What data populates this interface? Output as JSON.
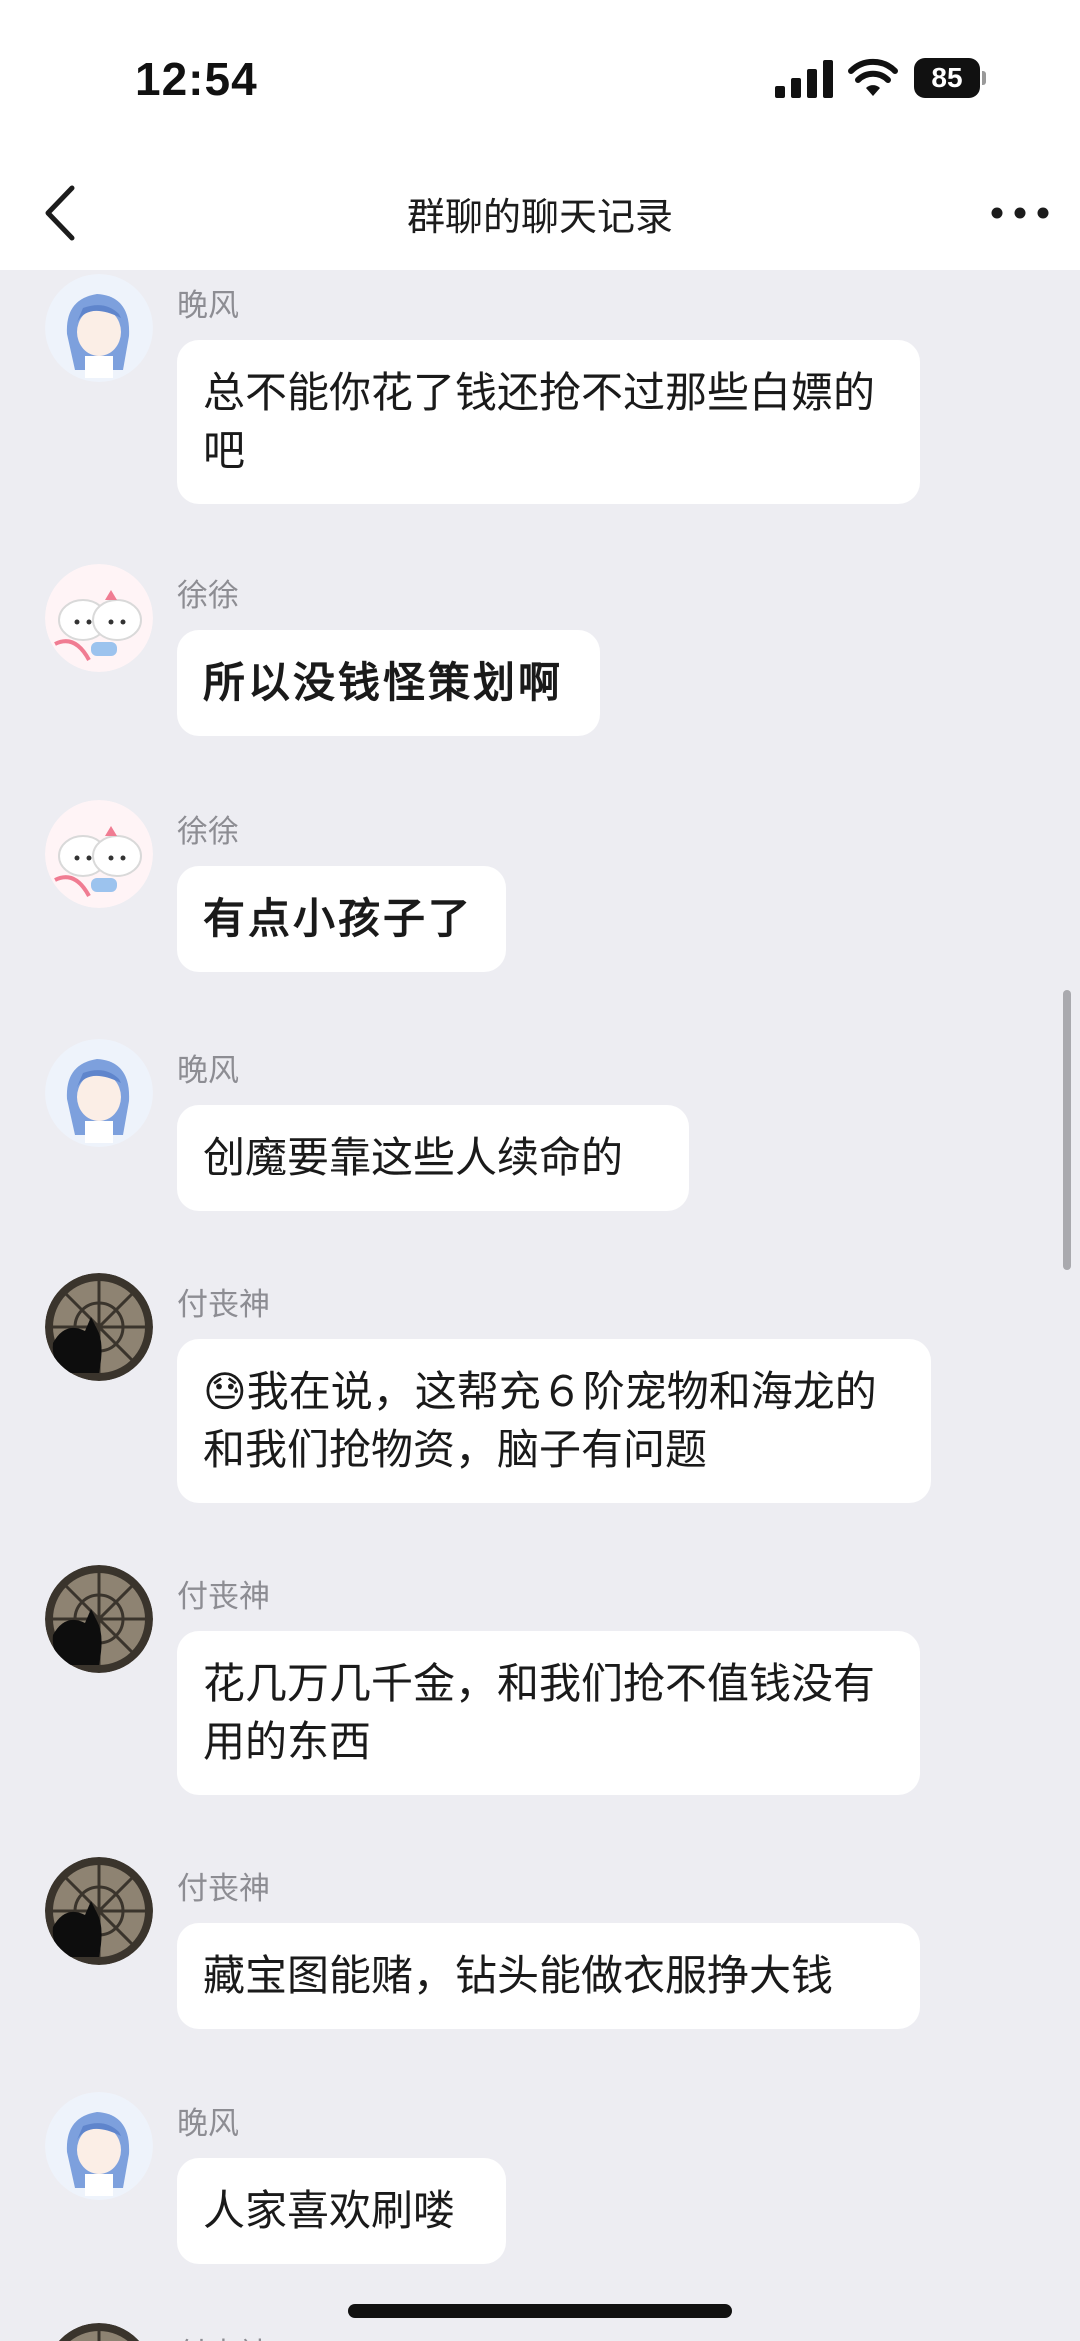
{
  "status_bar": {
    "time": "12:54",
    "battery": "85",
    "icons": [
      "signal-icon",
      "wifi-icon",
      "battery-icon"
    ]
  },
  "nav": {
    "title": "群聊的聊天记录",
    "back_icon": "chevron-left-icon",
    "more_icon": "more-dots-icon"
  },
  "messages": [
    {
      "sender": "晚风",
      "text": "总不能你花了钱还抢不过那些白嫖的吧",
      "avatar": "anime-girl-avatar"
    },
    {
      "sender": "徐徐",
      "text": "所以没钱怪策划啊",
      "avatar": "hello-kitty-avatar"
    },
    {
      "sender": "徐徐",
      "text": "有点小孩子了",
      "avatar": "hello-kitty-avatar"
    },
    {
      "sender": "晚风",
      "text": "创魔要靠这些人续命的",
      "avatar": "anime-girl-avatar"
    },
    {
      "sender": "付丧神",
      "emoji": "😓",
      "text": "我在说，这帮充６阶宠物和海龙的和我们抢物资，脑子有问题",
      "avatar": "dark-cat-avatar"
    },
    {
      "sender": "付丧神",
      "text": "花几万几千金，和我们抢不值钱没有用的东西",
      "avatar": "dark-cat-avatar"
    },
    {
      "sender": "付丧神",
      "text": "藏宝图能赌，钻头能做衣服挣大钱",
      "avatar": "dark-cat-avatar"
    },
    {
      "sender": "晚风",
      "text": "人家喜欢刷喽",
      "avatar": "anime-girl-avatar"
    },
    {
      "sender": "付丧神",
      "avatar": "dark-cat-avatar"
    }
  ]
}
